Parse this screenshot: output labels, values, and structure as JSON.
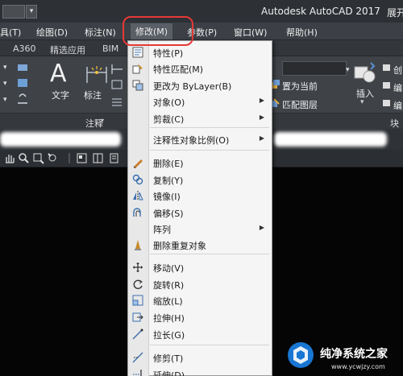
{
  "titlebar": {
    "app_title": "Autodesk AutoCAD 2017",
    "extra": "展开"
  },
  "menubar": {
    "items": [
      "具(T)",
      "绘图(D)",
      "标注(N)",
      "修改(M)",
      "参数(P)",
      "窗口(W)",
      "帮助(H)"
    ]
  },
  "ribbon": {
    "tabs": [
      "A360",
      "精选应用",
      "BIM"
    ],
    "text_label": "文字",
    "dim_label": "标注",
    "panel_annotation": "注释",
    "set_current": "置为当前",
    "match_layer": "匹配图层",
    "insert_label": "插入",
    "panel_block": "块",
    "right_stub_1": "创",
    "right_stub_2": "编",
    "right_stub_3": "编"
  },
  "modify_menu": {
    "items": [
      {
        "label": "特性(P)",
        "icon": "properties-icon",
        "submenu": false
      },
      {
        "label": "特性匹配(M)",
        "icon": "match-properties-icon",
        "submenu": false
      },
      {
        "label": "更改为 ByLayer(B)",
        "icon": "bylayer-icon",
        "submenu": false
      },
      {
        "label": "对象(O)",
        "icon": "",
        "submenu": true
      },
      {
        "label": "剪裁(C)",
        "icon": "",
        "submenu": true
      },
      {
        "label": "注释性对象比例(O)",
        "icon": "",
        "submenu": true
      },
      {
        "label": "删除(E)",
        "icon": "erase-icon",
        "submenu": false
      },
      {
        "label": "复制(Y)",
        "icon": "copy-icon",
        "submenu": false
      },
      {
        "label": "镜像(I)",
        "icon": "mirror-icon",
        "submenu": false
      },
      {
        "label": "偏移(S)",
        "icon": "offset-icon",
        "submenu": false
      },
      {
        "label": "阵列",
        "icon": "",
        "submenu": true
      },
      {
        "label": "删除重复对象",
        "icon": "overkill-icon",
        "submenu": false
      },
      {
        "label": "移动(V)",
        "icon": "move-icon",
        "submenu": false
      },
      {
        "label": "旋转(R)",
        "icon": "rotate-icon",
        "submenu": false
      },
      {
        "label": "缩放(L)",
        "icon": "scale-icon",
        "submenu": false
      },
      {
        "label": "拉伸(H)",
        "icon": "stretch-icon",
        "submenu": false
      },
      {
        "label": "拉长(G)",
        "icon": "lengthen-icon",
        "submenu": false
      },
      {
        "label": "修剪(T)",
        "icon": "trim-icon",
        "submenu": false
      },
      {
        "label": "延伸(D)",
        "icon": "extend-icon",
        "submenu": false
      }
    ]
  },
  "watermark": {
    "text": "纯净系统之家",
    "url": "www.ycwjzy.com"
  },
  "colors": {
    "highlight_ring": "#e53935",
    "menu_bg": "#f5f5f5",
    "ui_dark": "#3c3f45"
  }
}
